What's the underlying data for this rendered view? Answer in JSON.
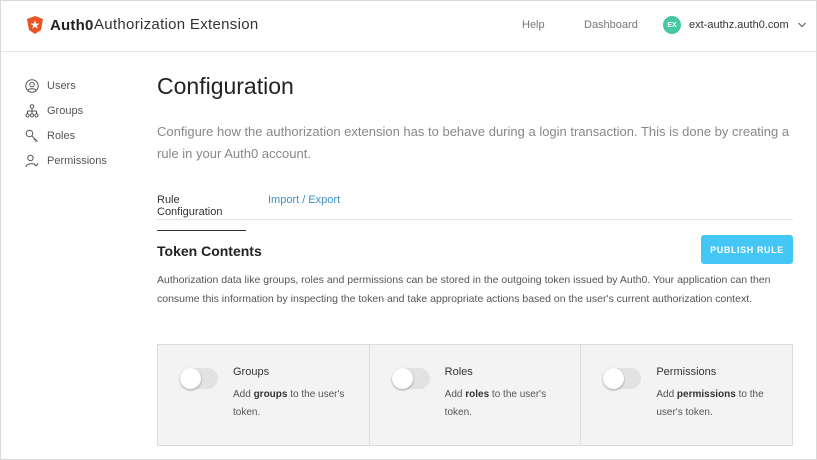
{
  "header": {
    "logo_text": "Auth0",
    "app_title": "Authorization Extension",
    "nav": {
      "help": "Help",
      "dashboard": "Dashboard"
    },
    "tenant": {
      "avatar_initials": "EX",
      "name": "ext-authz.auth0.com"
    }
  },
  "sidebar": {
    "items": [
      {
        "label": "Users",
        "icon": "user-circle-icon"
      },
      {
        "label": "Groups",
        "icon": "hierarchy-icon"
      },
      {
        "label": "Roles",
        "icon": "key-icon"
      },
      {
        "label": "Permissions",
        "icon": "user-permission-icon"
      }
    ]
  },
  "main": {
    "title": "Configuration",
    "description": "Configure how the authorization extension has to behave during a login transaction. This is done by creating a rule in your Auth0 account.",
    "tabs": [
      {
        "label": "Rule Configuration",
        "active": true
      },
      {
        "label": "Import / Export",
        "active": false
      }
    ],
    "section": {
      "title": "Token Contents",
      "publish_label": "PUBLISH RULE",
      "description": "Authorization data like groups, roles and permissions can be stored in the outgoing token issued by Auth0. Your application can then consume this information by inspecting the token and take appropriate actions based on the user's current authorization context."
    },
    "cards": [
      {
        "title": "Groups",
        "prefix": "Add ",
        "keyword": "groups",
        "suffix": " to the user's token.",
        "enabled": false
      },
      {
        "title": "Roles",
        "prefix": "Add ",
        "keyword": "roles",
        "suffix": " to the user's token.",
        "enabled": false
      },
      {
        "title": "Permissions",
        "prefix": "Add ",
        "keyword": "permissions",
        "suffix": " to the user's token.",
        "enabled": false
      }
    ]
  },
  "colors": {
    "accent": "#44c7f4",
    "link": "#3b91c6",
    "brand": "#eb5424",
    "avatar": "#44c7a2"
  }
}
